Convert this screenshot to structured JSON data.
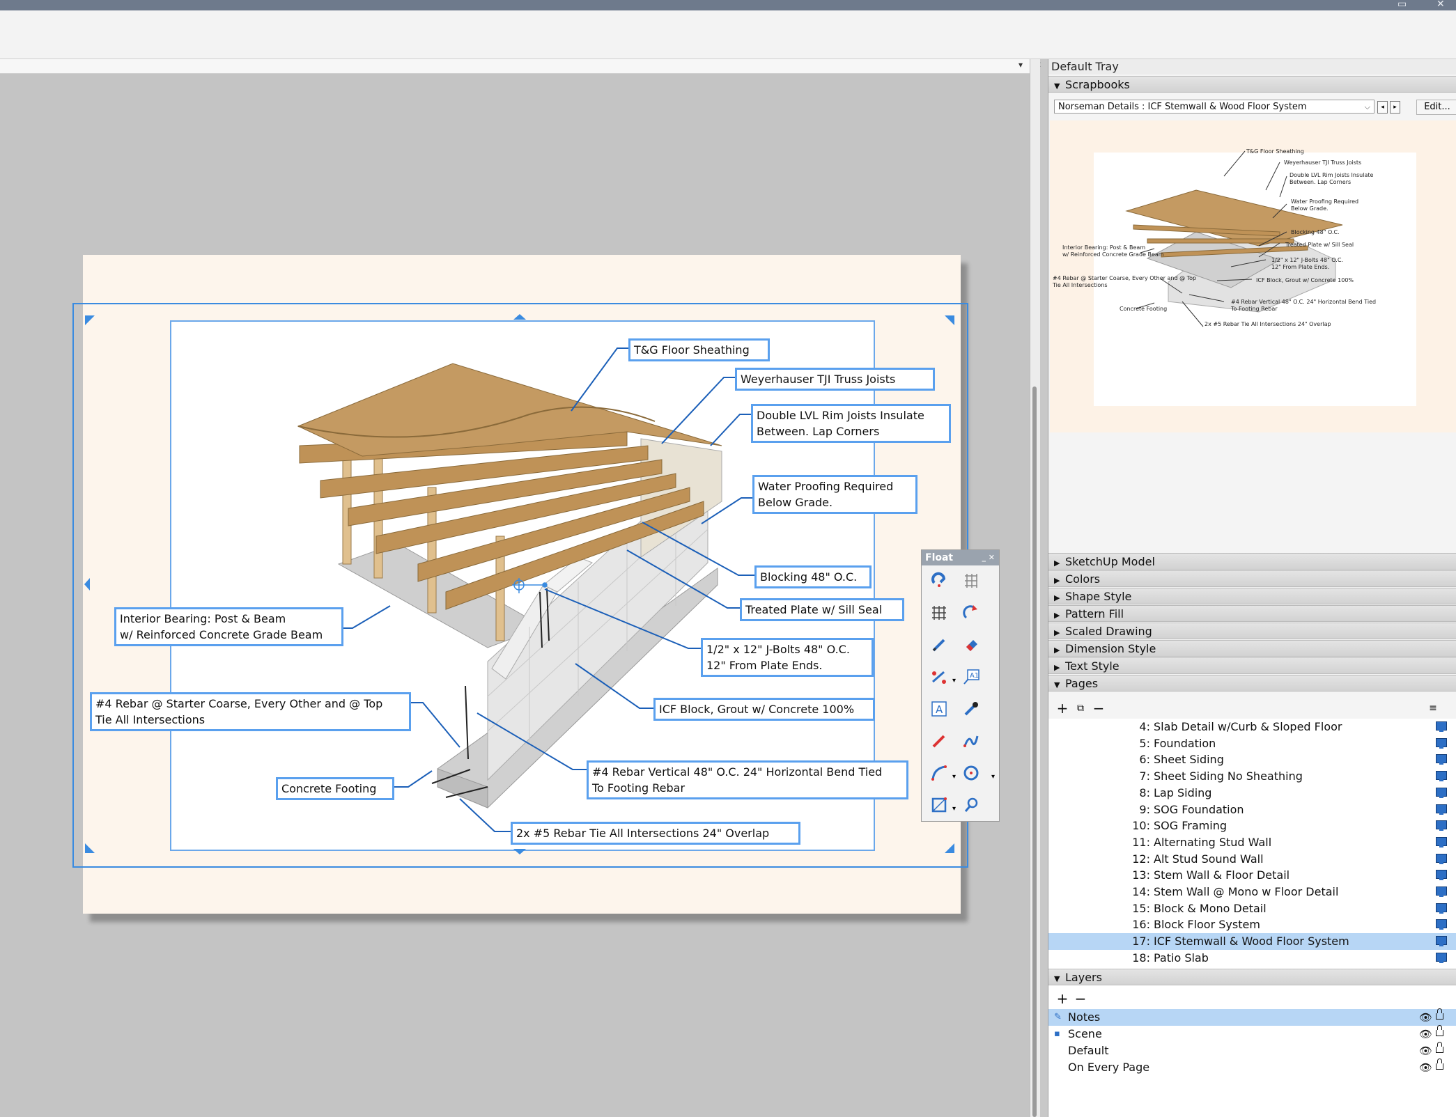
{
  "document": {
    "notes": {
      "tg_floor": "T&G Floor Sheathing",
      "tji": "Weyerhauser TJI Truss Joists",
      "lvl_line1": "Double LVL Rim Joists Insulate",
      "lvl_line2": "Between. Lap Corners",
      "water_line1": "Water Proofing Required",
      "water_line2": " Below Grade.",
      "blocking": "Blocking 48\" O.C.",
      "treated": "Treated Plate w/ Sill Seal",
      "jbolt_line1": "1/2\" x 12\" J-Bolts 48\" O.C.",
      "jbolt_line2": "12\" From Plate Ends.",
      "icf": "ICF Block, Grout w/ Concrete 100%",
      "rebar_vert_line1": "#4 Rebar Vertical 48\" O.C. 24\" Horizontal Bend Tied",
      "rebar_vert_line2": "To Footing Rebar",
      "rebar_tie": "2x #5 Rebar Tie All Intersections 24\" Overlap",
      "interior_line1": "Interior Bearing: Post & Beam",
      "interior_line2": "w/ Reinforced Concrete Grade Beam",
      "starter_line1": "#4 Rebar @ Starter Coarse, Every Other and @ Top",
      "starter_line2": "Tie All Intersections",
      "footing": "Concrete Footing"
    }
  },
  "float_palette": {
    "title": "Float",
    "tools": [
      "select-icon",
      "grid-snap-icon",
      "grid-icon",
      "rotate-icon",
      "pencil-icon",
      "eraser-icon",
      "dimension-icon",
      "label-icon",
      "text-icon",
      "eyedropper-icon",
      "line-icon",
      "freehand-icon",
      "arc-icon",
      "circle-icon",
      "rectangle-icon",
      "zoom-icon"
    ]
  },
  "tray": {
    "title": "Default Tray",
    "scrapbooks": {
      "header": "Scrapbooks",
      "selected": "Norseman Details : ICF Stemwall & Wood Floor System",
      "edit_label": "Edit...",
      "preview_labels": {
        "tg": "T&G Floor Sheathing",
        "tji": "Weyerhauser TJI Truss Joists",
        "lvl1": "Double LVL Rim Joists Insulate",
        "lvl2": "Between. Lap Corners",
        "water1": "Water Proofing Required",
        "water2": "Below Grade.",
        "blocking": "Blocking 48\" O.C.",
        "treated": "Treated Plate w/ Sill Seal",
        "jbolt1": "1/2\" x 12\" J-Bolts 48\" O.C.",
        "jbolt2": "12\" From Plate Ends.",
        "icf": "ICF Block, Grout w/ Concrete 100%",
        "vert1": "#4 Rebar Vertical 48\" O.C. 24\" Horizontal Bend Tied",
        "vert2": "To Footing Rebar",
        "tie": "2x #5 Rebar Tie All Intersections 24\" Overlap",
        "int1": "Interior Bearing: Post & Beam",
        "int2": "w/ Reinforced Concrete Grade Beam",
        "start1": "#4 Rebar @ Starter Coarse, Every Other and @ Top",
        "start2": "Tie All Intersections",
        "footing": "Concrete Footing"
      }
    },
    "sections": [
      "SketchUp Model",
      "Colors",
      "Shape Style",
      "Pattern Fill",
      "Scaled Drawing",
      "Dimension Style",
      "Text Style"
    ],
    "pages": {
      "header": "Pages",
      "items": [
        {
          "num": "4:",
          "label": "Slab Detail w/Curb & Sloped Floor"
        },
        {
          "num": "5:",
          "label": "Foundation"
        },
        {
          "num": "6:",
          "label": "Sheet Siding"
        },
        {
          "num": "7:",
          "label": "Sheet Siding No Sheathing"
        },
        {
          "num": "8:",
          "label": "Lap Siding"
        },
        {
          "num": "9:",
          "label": "SOG Foundation"
        },
        {
          "num": "10:",
          "label": "SOG Framing"
        },
        {
          "num": "11:",
          "label": "Alternating Stud Wall"
        },
        {
          "num": "12:",
          "label": "Alt Stud Sound Wall"
        },
        {
          "num": "13:",
          "label": "Stem Wall & Floor Detail"
        },
        {
          "num": "14:",
          "label": "Stem Wall @ Mono w Floor Detail"
        },
        {
          "num": "15:",
          "label": "Block & Mono Detail"
        },
        {
          "num": "16:",
          "label": "Block Floor System"
        },
        {
          "num": "17:",
          "label": "ICF Stemwall & Wood Floor System"
        },
        {
          "num": "18:",
          "label": "Patio Slab"
        }
      ],
      "selected_index": 13
    },
    "layers": {
      "header": "Layers",
      "items": [
        {
          "label": "Notes"
        },
        {
          "label": "Scene"
        },
        {
          "label": "Default"
        },
        {
          "label": "On Every Page"
        }
      ],
      "selected_index": 0
    }
  },
  "colors": {
    "selection": "#3a8be0",
    "note_border": "#5aa0ee",
    "paper": "#fdf5ec",
    "plywood": "#c49a62",
    "icf": "#e4e4e4",
    "concrete": "#d6d6d6",
    "page_selected": "#b7d6f5"
  }
}
